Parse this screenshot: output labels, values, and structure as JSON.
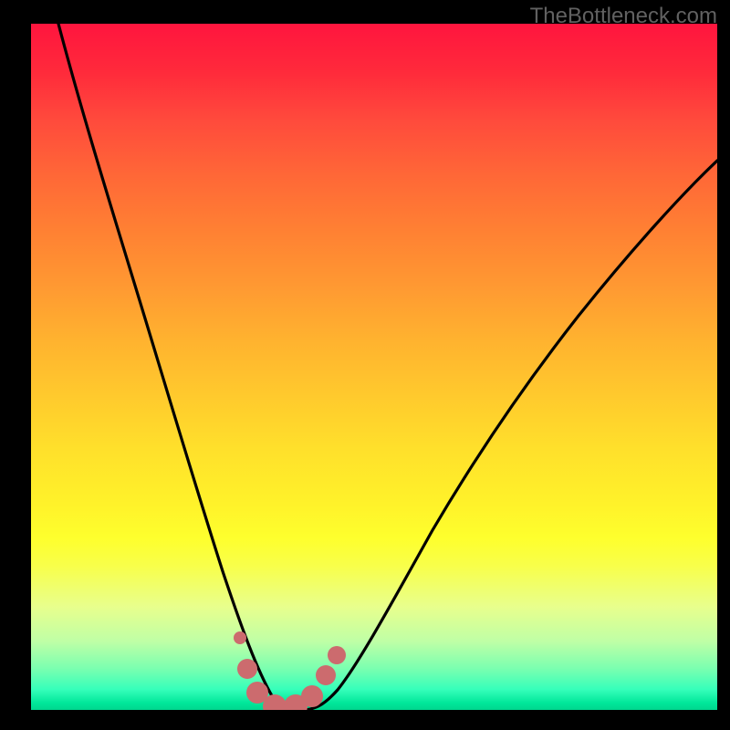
{
  "watermark": "TheBottleneck.com",
  "colors": {
    "frame": "#000000",
    "curve": "#000000",
    "marker_fill": "#cc6b6e",
    "marker_stroke": "#cc6b6e"
  },
  "chart_data": {
    "type": "line",
    "title": "",
    "xlabel": "",
    "ylabel": "",
    "xlim": [
      0,
      100
    ],
    "ylim": [
      0,
      100
    ],
    "grid": false,
    "legend": null,
    "description": "V-shaped bottleneck curve over a vertical rainbow heat gradient (red = high bottleneck at top, green = no bottleneck at bottom). The curve descends steeply from the top-left, reaches a flat minimum near x ≈ 33–40 at y ≈ 0–2, then rises with a gentler concave slope toward the top-right. A cluster of salmon-colored markers highlights the optimal (minimum) region.",
    "series": [
      {
        "name": "bottleneck-curve",
        "x": [
          4,
          7,
          10,
          13,
          16,
          19,
          22,
          25,
          28,
          30,
          32,
          34,
          36,
          38,
          40,
          42,
          45,
          50,
          55,
          60,
          65,
          70,
          75,
          80,
          85,
          90,
          95,
          100
        ],
        "y": [
          100,
          90,
          80,
          70,
          60,
          50,
          41,
          32,
          22,
          15,
          9,
          4,
          1,
          0,
          0,
          1,
          4,
          10,
          18,
          26,
          34,
          42,
          49,
          56,
          62,
          68,
          73,
          78
        ]
      }
    ],
    "markers": [
      {
        "x": 30.5,
        "y": 10.5,
        "r": 1.0
      },
      {
        "x": 31.5,
        "y": 6.0,
        "r": 1.5
      },
      {
        "x": 33.0,
        "y": 2.5,
        "r": 1.7
      },
      {
        "x": 35.5,
        "y": 0.5,
        "r": 1.8
      },
      {
        "x": 38.5,
        "y": 0.5,
        "r": 1.8
      },
      {
        "x": 41.0,
        "y": 2.0,
        "r": 1.7
      },
      {
        "x": 43.0,
        "y": 5.0,
        "r": 1.5
      },
      {
        "x": 44.5,
        "y": 8.0,
        "r": 1.3
      }
    ]
  }
}
